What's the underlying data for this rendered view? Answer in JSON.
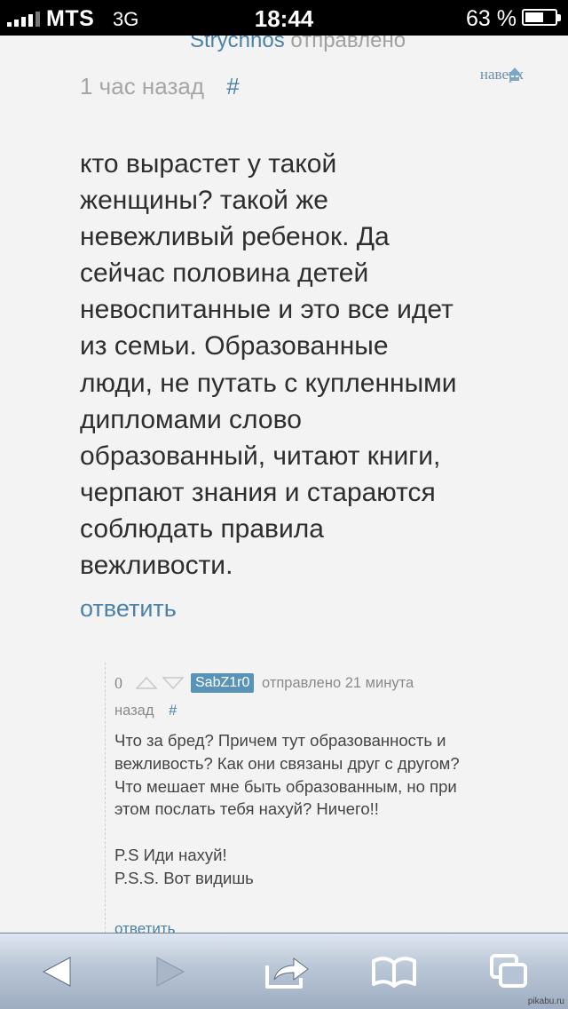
{
  "status_bar": {
    "carrier": "MTS",
    "network": "3G",
    "time": "18:44",
    "battery_label": "63 %",
    "battery_level": 0.63
  },
  "parent_comment": {
    "prev_user": "Strychnos",
    "prev_sent_label": "отправлено",
    "time_ago": "1 час назад",
    "anchor": "#",
    "to_top_label": "наверх",
    "text": "кто вырастет у такой женщины? такой же невежливый ребенок. Да сейчас половина детей невоспитанные и это все идет из семьи. Образованные люди, не путать с купленными дипломами слово образованный, читают книги, черпают знания и стараются соблюдать правила вежливости.",
    "reply_label": "ответить"
  },
  "reply_comment": {
    "rating": "0",
    "username": "SabZ1r0",
    "sent_line": "отправлено 21 минута",
    "sent_line_cont": "назад",
    "anchor": "#",
    "text_para1": "Что за бред? Причем тут образованность и вежливость? Как они связаны друг с другом? Что мешает мне быть образованным, но при этом послать тебя нахуй? Ничего!!",
    "text_ps1": "P.S Иди нахуй!",
    "text_ps2": "P.S.S. Вот видишь",
    "reply_label": "ответить"
  },
  "toolbar": {
    "icons": [
      "back-arrow-icon",
      "forward-arrow-icon",
      "share-icon",
      "bookmarks-icon",
      "tabs-icon"
    ]
  },
  "watermark": "pikabu.ru",
  "colors": {
    "link": "#4a82a8",
    "badge": "#5a93b8",
    "toolbar_top": "#dfe6f0",
    "toolbar_bottom": "#9eadc1"
  }
}
